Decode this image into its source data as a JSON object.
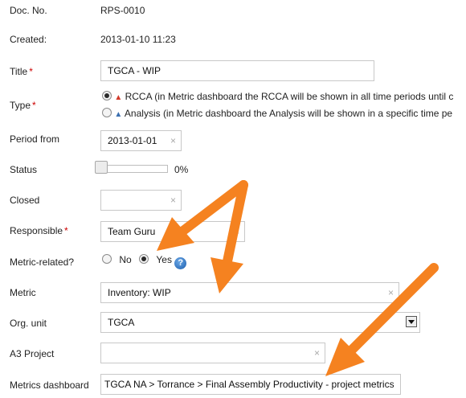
{
  "form": {
    "doc_no": {
      "label": "Doc. No.",
      "value": "RPS-0010"
    },
    "created": {
      "label": "Created:",
      "value": "2013-01-10 11:23"
    },
    "title": {
      "label": "Title",
      "required_mark": "*",
      "value": "TGCA - WIP"
    },
    "type": {
      "label": "Type",
      "required_mark": "*",
      "options": [
        {
          "label": "RCCA (in Metric dashboard the RCCA will be shown in all time periods until c",
          "selected": true,
          "icon": "warning-red-icon"
        },
        {
          "label": "Analysis (in Metric dashboard the Analysis will be shown in a specific time pe",
          "selected": false,
          "icon": "warning-blue-icon"
        }
      ]
    },
    "period_from": {
      "label": "Period from",
      "value": "2013-01-01"
    },
    "status": {
      "label": "Status",
      "percent_text": "0%",
      "progress": 0
    },
    "closed": {
      "label": "Closed",
      "value": ""
    },
    "responsible": {
      "label": "Responsible",
      "required_mark": "*",
      "value": "Team Guru"
    },
    "metric_related": {
      "label": "Metric-related?",
      "no_label": "No",
      "yes_label": "Yes",
      "selected": "yes",
      "help_glyph": "?"
    },
    "metric": {
      "label": "Metric",
      "value": "Inventory: WIP"
    },
    "org_unit": {
      "label": "Org. unit",
      "value": "TGCA"
    },
    "a3_project": {
      "label": "A3 Project",
      "value": ""
    },
    "metrics_dashboard": {
      "label": "Metrics dashboard",
      "value": "TGCA NA > Torrance > Final Assembly Productivity  - project metrics"
    }
  },
  "clear_glyph": "×",
  "colors": {
    "annotation_arrow": "#f58220",
    "required": "#cc0000"
  }
}
